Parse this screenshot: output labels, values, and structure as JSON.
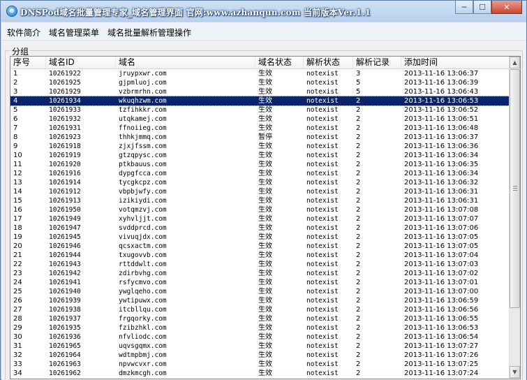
{
  "window": {
    "app_icon": "globe-icon",
    "title": "DNSPod域名批量管理专家_域名管理界面  官网:www.azhanqun.com  当前版本Ver.1.1",
    "buttons": {
      "minimize": "─",
      "maximize": "☐",
      "close": "✕"
    }
  },
  "menu": [
    {
      "label": "软件简介"
    },
    {
      "label": "域名管理菜单"
    },
    {
      "label": "域名批量解析管理操作"
    }
  ],
  "group": {
    "label": "分组"
  },
  "table": {
    "headers": [
      "序号",
      "域名ID",
      "域名",
      "域名状态",
      "解析状态",
      "解析记录",
      "添加时间"
    ],
    "selected_index": 3,
    "rows": [
      [
        "1",
        "10261922",
        "jruypxwr.com",
        "生效",
        "notexist",
        "3",
        "2013-11-16 13:06:37"
      ],
      [
        "2",
        "10261925",
        "gjpmluoj.com",
        "生效",
        "notexist",
        "5",
        "2013-11-16 13:06:39"
      ],
      [
        "3",
        "10261929",
        "vzbrmrhn.com",
        "生效",
        "notexist",
        "5",
        "2013-11-16 13:06:43"
      ],
      [
        "4",
        "10261934",
        "wkuqhzwm.com",
        "生效",
        "notexist",
        "2",
        "2013-11-16 13:06:53"
      ],
      [
        "5",
        "10261933",
        "tzfihkkr.com",
        "生效",
        "notexist",
        "2",
        "2013-11-16 13:06:52"
      ],
      [
        "6",
        "10261932",
        "utqkamej.com",
        "生效",
        "notexist",
        "2",
        "2013-11-16 13:06:51"
      ],
      [
        "7",
        "10261931",
        "ffnoiieg.com",
        "生效",
        "notexist",
        "2",
        "2013-11-16 13:06:48"
      ],
      [
        "8",
        "10261923",
        "thhkjmmq.com",
        "暂停",
        "notexist",
        "2",
        "2013-11-16 13:06:37"
      ],
      [
        "9",
        "10261918",
        "zjxjfssm.com",
        "生效",
        "notexist",
        "2",
        "2013-11-16 13:06:36"
      ],
      [
        "10",
        "10261919",
        "gtzqpysc.com",
        "生效",
        "notexist",
        "2",
        "2013-11-16 13:06:34"
      ],
      [
        "11",
        "10261920",
        "ptkbauus.com",
        "生效",
        "notexist",
        "2",
        "2013-11-16 13:06:35"
      ],
      [
        "12",
        "10261916",
        "dypgfcca.com",
        "生效",
        "notexist",
        "2",
        "2013-11-16 13:06:34"
      ],
      [
        "13",
        "10261914",
        "tycgkcpz.com",
        "生效",
        "notexist",
        "2",
        "2013-11-16 13:06:32"
      ],
      [
        "14",
        "10261912",
        "vbpbjwfy.com",
        "生效",
        "notexist",
        "2",
        "2013-11-16 13:06:31"
      ],
      [
        "15",
        "10261913",
        "izikiydi.com",
        "生效",
        "notexist",
        "2",
        "2013-11-16 13:06:31"
      ],
      [
        "16",
        "10261950",
        "votqmzvj.com",
        "生效",
        "notexist",
        "2",
        "2013-11-16 13:07:08"
      ],
      [
        "17",
        "10261949",
        "xyhvljjt.com",
        "生效",
        "notexist",
        "2",
        "2013-11-16 13:07:07"
      ],
      [
        "18",
        "10261947",
        "svddprcd.com",
        "生效",
        "notexist",
        "2",
        "2013-11-16 13:07:06"
      ],
      [
        "19",
        "10261945",
        "vivuqjdx.com",
        "生效",
        "notexist",
        "2",
        "2013-11-16 13:07:05"
      ],
      [
        "20",
        "10261946",
        "qcsxactm.com",
        "生效",
        "notexist",
        "2",
        "2013-11-16 13:07:05"
      ],
      [
        "21",
        "10261944",
        "txugovvb.com",
        "生效",
        "notexist",
        "2",
        "2013-11-16 13:07:04"
      ],
      [
        "22",
        "10261943",
        "rttddwlt.com",
        "生效",
        "notexist",
        "2",
        "2013-11-16 13:07:03"
      ],
      [
        "23",
        "10261942",
        "zdirbvhg.com",
        "生效",
        "notexist",
        "2",
        "2013-11-16 13:07:02"
      ],
      [
        "24",
        "10261941",
        "rsfycmvo.com",
        "生效",
        "notexist",
        "2",
        "2013-11-16 13:07:01"
      ],
      [
        "25",
        "10261940",
        "ywglqeho.com",
        "生效",
        "notexist",
        "2",
        "2013-11-16 13:07:00"
      ],
      [
        "26",
        "10261939",
        "ywtipuwx.com",
        "生效",
        "notexist",
        "2",
        "2013-11-16 13:06:59"
      ],
      [
        "27",
        "10261938",
        "itcbllqu.com",
        "生效",
        "notexist",
        "2",
        "2013-11-16 13:06:56"
      ],
      [
        "28",
        "10261937",
        "frgqorky.com",
        "生效",
        "notexist",
        "2",
        "2013-11-16 13:06:55"
      ],
      [
        "29",
        "10261935",
        "fzibzhkl.com",
        "生效",
        "notexist",
        "2",
        "2013-11-16 13:06:53"
      ],
      [
        "30",
        "10261936",
        "nfvliodc.com",
        "生效",
        "notexist",
        "2",
        "2013-11-16 13:06:54"
      ],
      [
        "31",
        "10261965",
        "uqvsgqmx.com",
        "生效",
        "notexist",
        "2",
        "2013-11-16 13:07:27"
      ],
      [
        "32",
        "10261964",
        "wdtmpbmj.com",
        "生效",
        "notexist",
        "2",
        "2013-11-16 13:07:26"
      ],
      [
        "33",
        "10261963",
        "npvwcvxr.com",
        "生效",
        "notexist",
        "2",
        "2013-11-16 13:07:25"
      ],
      [
        "34",
        "10261962",
        "dmzkmcgh.com",
        "生效",
        "notexist",
        "2",
        "2013-11-16 13:07:24"
      ]
    ]
  },
  "scrollbar": {
    "up_icon": "▲",
    "down_icon": "▼"
  }
}
